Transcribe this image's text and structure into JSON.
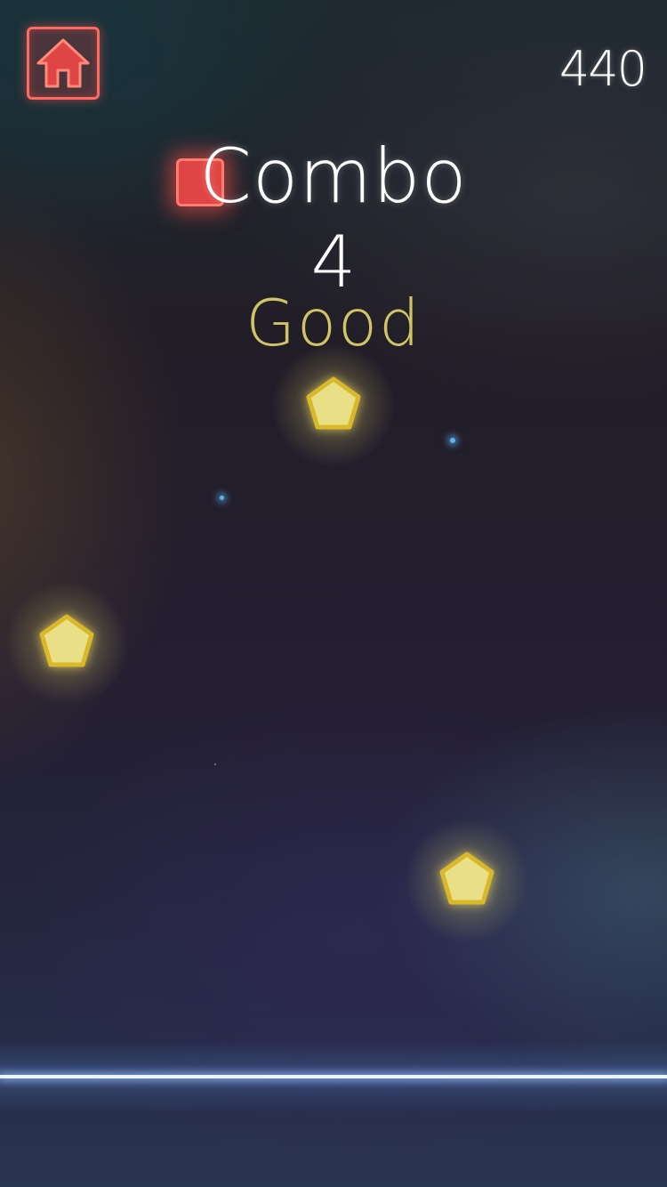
{
  "hud": {
    "home_icon": "home-icon",
    "score": "440"
  },
  "feedback": {
    "combo_label": "Combo",
    "combo_count": "4",
    "rating": "Good"
  },
  "colors": {
    "accent_red": "#ff6a60",
    "note_yellow": "#e8d96a",
    "rating_yellow": "#cfc566",
    "hit_line": "#eef4ff"
  },
  "notes": [
    {
      "shape": "pentagon-icon"
    },
    {
      "shape": "pentagon-icon"
    },
    {
      "shape": "pentagon-icon"
    }
  ]
}
